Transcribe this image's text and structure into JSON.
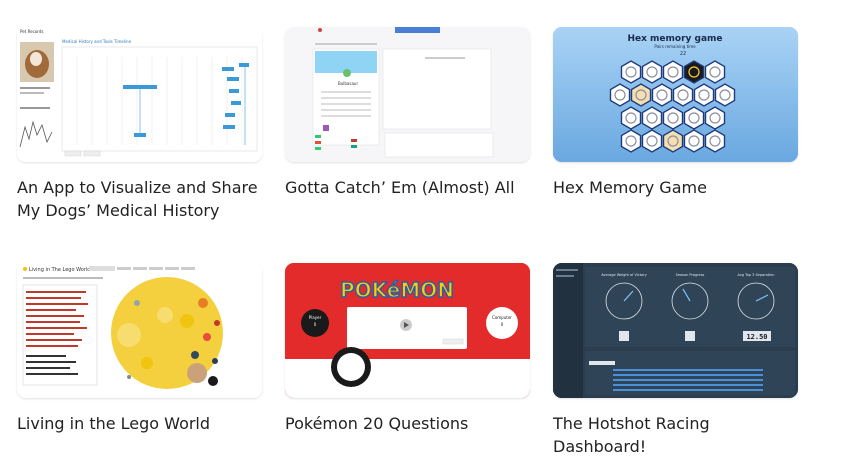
{
  "cards": [
    {
      "title": "An App to Visualize and Share My Dogs’ Medical History",
      "thumb_label": "Pet Records",
      "thumb_subtitle": "Medical History and Tools Timeline"
    },
    {
      "title": "Gotta Catch’ Em (Almost) All",
      "thumb_label": "Bulbasaur"
    },
    {
      "title": "Hex Memory Game",
      "thumb_label": "Hex memory game",
      "thumb_sub": "Pairs remaining time",
      "thumb_count": "22"
    },
    {
      "title": "Living in the Lego World",
      "thumb_label": "Living in The Lego World"
    },
    {
      "title": "Pokémon 20 Questions",
      "thumb_label": "POKéMON",
      "player_label": "Player",
      "player_score": "0",
      "computer_label": "Computer",
      "computer_score": "0"
    },
    {
      "title": "The Hotshot Racing Dashboard!",
      "gauge_labels": [
        "Average Weight of Victory",
        "Season Progress",
        "Avg Top 3 Separation"
      ],
      "odometer_value": "12.50"
    }
  ],
  "colors": {
    "hex_bg": "#8ec3ef",
    "pokemon_red": "#e32b2b",
    "dash_bg": "#2b3d4f",
    "lego_yellow": "#f4d03f"
  }
}
